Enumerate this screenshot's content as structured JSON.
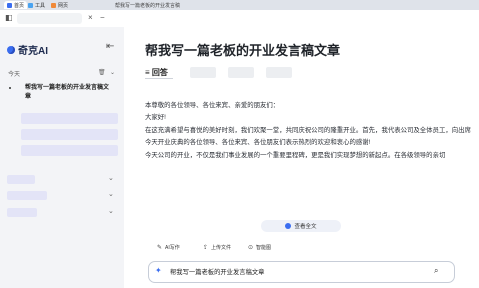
{
  "browser": {
    "tabs": [
      {
        "label": "首页"
      },
      {
        "label": "工具"
      },
      {
        "label": "网页"
      }
    ],
    "page_title": "帮我写一篇老板的开业发言稿"
  },
  "sidebar": {
    "brand": "奇克AI",
    "section_today": "今天",
    "history": [
      {
        "label": "帮我写一篇老板的开业发言稿文章"
      }
    ]
  },
  "main": {
    "title": "帮我写一篇老板的开业发言稿文章",
    "answer_tab": "回答",
    "paragraphs": [
      "本尊敬的各位领导、各位来宾、亲爱的朋友们：",
      "大家好!",
      "在这充满希望与喜悦的美好时刻，我们欢聚一堂，共同庆祝公司的隆重开业。首先，我代表公司及全体员工，向出席今天开业庆典的各位领导、各位来宾、各位朋友们表示热烈的欢迎和衷心的感谢!",
      "今天公司的开业，不仅是我们事业发展的一个重要里程碑，更是我们实现梦想的新起点。在各级领导的亲切"
    ],
    "see_all": "查看全文",
    "tools": [
      {
        "label": "AI写作",
        "icon": "pen-icon"
      },
      {
        "label": "上传文件",
        "icon": "upload-icon"
      },
      {
        "label": "智能图",
        "icon": "image-icon"
      }
    ],
    "input_text": "帮我写一篇老板的开业发言稿文章"
  }
}
